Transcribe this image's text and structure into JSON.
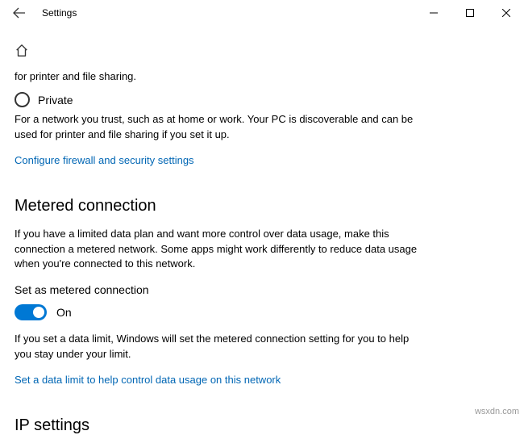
{
  "window": {
    "title": "Settings"
  },
  "truncated_line": "for printer and file sharing.",
  "network_profile": {
    "private": {
      "label": "Private",
      "description": "For a network you trust, such as at home or work. Your PC is discoverable and can be used for printer and file sharing if you set it up."
    },
    "firewall_link": "Configure firewall and security settings"
  },
  "metered": {
    "heading": "Metered connection",
    "description": "If you have a limited data plan and want more control over data usage, make this connection a metered network. Some apps might work differently to reduce data usage when you're connected to this network.",
    "toggle_label": "Set as metered connection",
    "toggle_state": "On",
    "limit_note": "If you set a data limit, Windows will set the metered connection setting for you to help you stay under your limit.",
    "data_limit_link": "Set a data limit to help control data usage on this network"
  },
  "ip": {
    "heading": "IP settings"
  },
  "watermark": "wsxdn.com"
}
